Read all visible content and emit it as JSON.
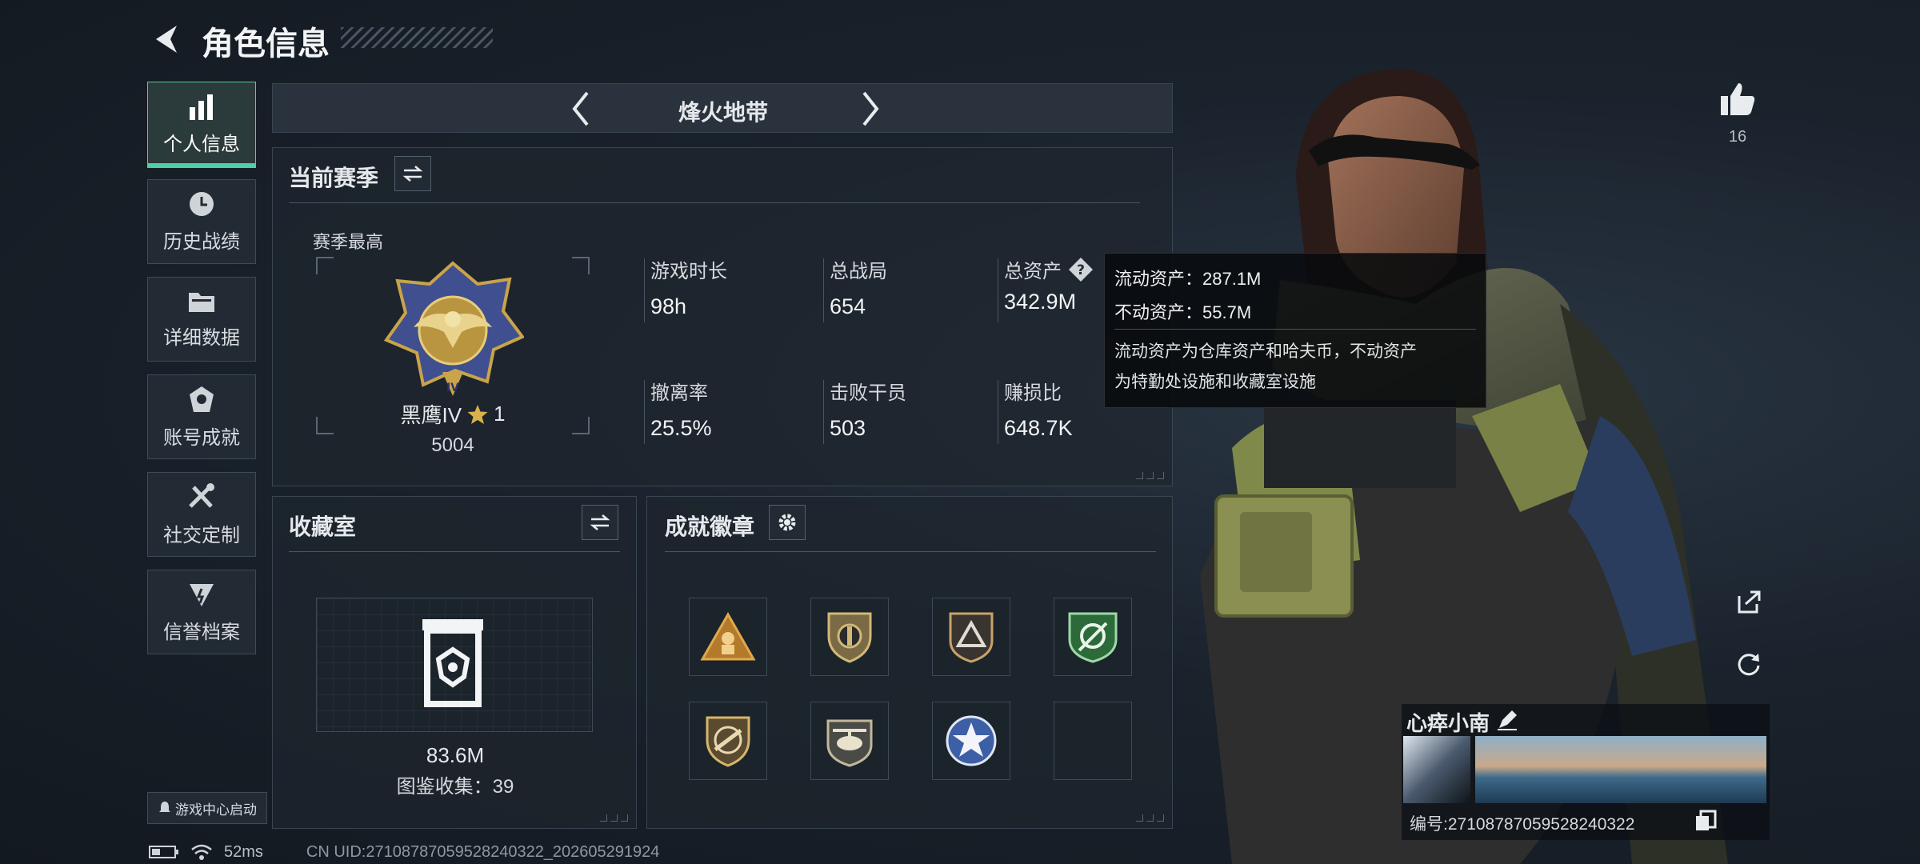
{
  "header": {
    "title": "角色信息"
  },
  "sidebar": {
    "items": [
      {
        "label": "个人信息",
        "icon": "bar-chart-icon",
        "active": true
      },
      {
        "label": "历史战绩",
        "icon": "clock-icon"
      },
      {
        "label": "详细数据",
        "icon": "folder-icon"
      },
      {
        "label": "账号成就",
        "icon": "achievement-icon"
      },
      {
        "label": "社交定制",
        "icon": "tools-icon"
      },
      {
        "label": "信誉档案",
        "icon": "reputation-icon"
      }
    ],
    "game_center_label": "游戏中心启动"
  },
  "mode_selector": {
    "label": "烽火地带"
  },
  "season": {
    "title": "当前赛季",
    "best_label": "赛季最高",
    "rank_name": "黑鹰IV",
    "rank_stars": "1",
    "rank_points": "5004",
    "stats": [
      {
        "label": "游戏时长",
        "value": "98h"
      },
      {
        "label": "总战局",
        "value": "654"
      },
      {
        "label": "总资产",
        "value": "342.9M",
        "help": true
      },
      {
        "label": "撤离率",
        "value": "25.5%"
      },
      {
        "label": "击败干员",
        "value": "503"
      },
      {
        "label": "赚损比",
        "value": "648.7K"
      }
    ]
  },
  "tooltip": {
    "liquid": "流动资产：287.1M",
    "fixed": "不动资产：55.7M",
    "desc_line1": "流动资产为仓库资产和哈夫币，不动资产",
    "desc_line2": "为特勤处设施和收藏室设施"
  },
  "collection": {
    "title": "收藏室",
    "value": "83.6M",
    "catalog": "图鉴收集：39"
  },
  "achievements": {
    "title": "成就徽章",
    "badges": [
      "triangle-soldier-badge",
      "shield-emblem-badge",
      "triangle-shield-badge",
      "green-crest-badge",
      "rifle-shield-badge",
      "helicopter-badge",
      "star-medal-badge",
      "empty-slot"
    ]
  },
  "profile": {
    "likes": "16",
    "nickname": "心瘁小南",
    "id_text": "编号:2710878705952824O322",
    "id_display": "编号:27108787059528240322"
  },
  "status_bar": {
    "latency": "52ms",
    "uid": "CN UID:27108787059528240322_202605291924"
  },
  "colors": {
    "accent": "#4fd0a6",
    "panel": "#1e262e",
    "gold": "#c9a44a"
  }
}
